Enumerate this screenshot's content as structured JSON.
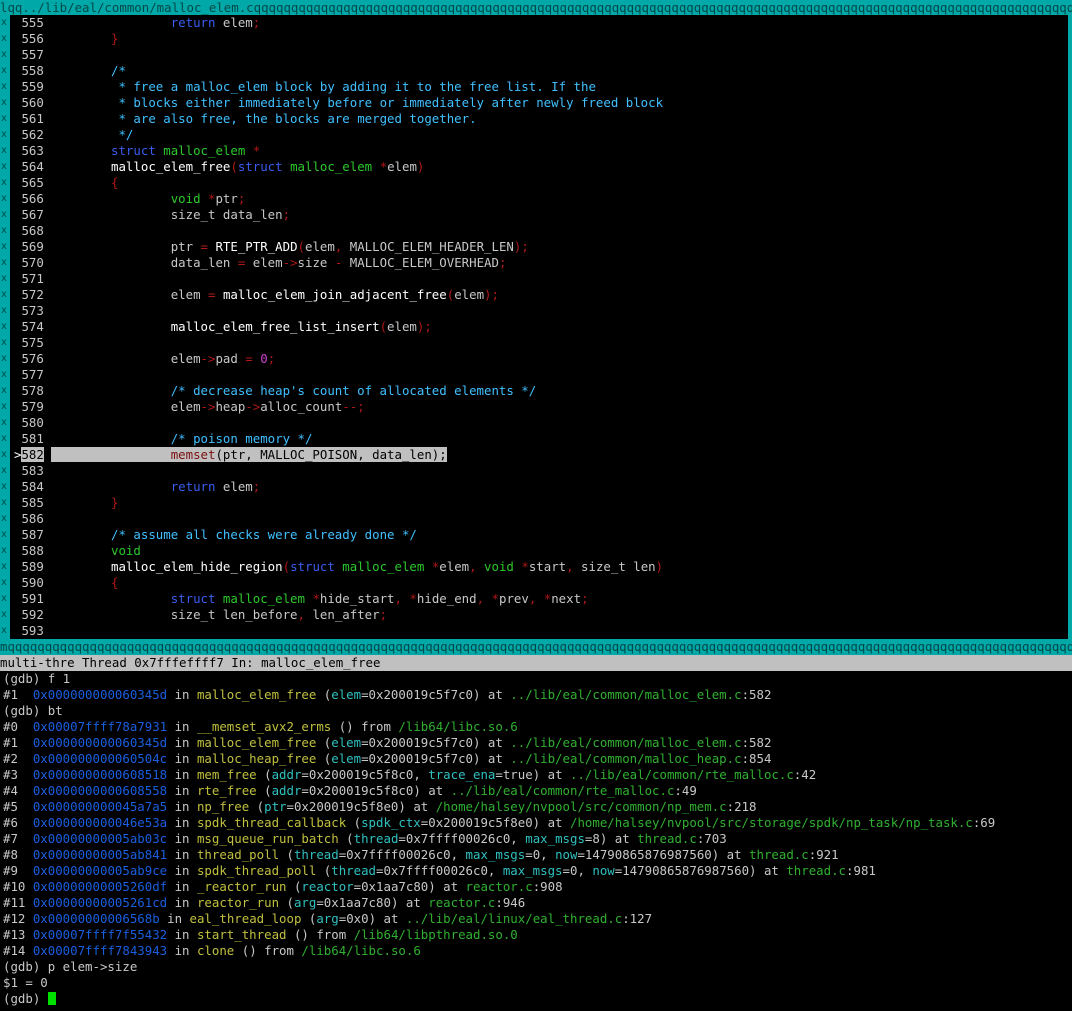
{
  "title_bar": "lqq../lib/eal/common/malloc_elem.cqqqqqqqqqqqqqqqqqqqqqqqqqqqqqqqqqqqqqqqqqqqqqqqqqqqqqqqqqqqqqqqqqqqqqqqqqqqqqqqqqqqqqqqqqqqqqqqqqqqqqqqqqqqqqqqqqqqqqqqqqqqqqqqqqqqqqqqqqqqqqqqqqqqqqqqqqqqqqqqqqqqqqqqqqqqqqqqqqqqqqqqqqqqqqqqqqqqqqqqqqqqq",
  "border_char": "x",
  "bottom_border": "mqqqqqqqqqqqqqqqqqqqqqqqqqqqqqqqqqqqqqqqqqqqqqqqqqqqqqqqqqqqqqqqqqqqqqqqqqqqqqqqqqqqqqqqqqqqqqqqqqqqqqqqqqqqqqqqqqqqqqqqqqqqqqqqqqqqqqqqqqqqqqqqqqqqqqqqqqqqqqqqqqqqqqqqqqqqqqqqqqqqqqqqqqqqqqqqqqqqqqqqqqqqqqqqqqqqqqqqqqqqqqqqqqqqqqqqqqqqqqqqqqqqq",
  "status_bar": "multi-thre Thread 0x7fffeffff7 In: malloc_elem_free",
  "current_line": 582,
  "source_lines": [
    {
      "n": 555,
      "t": [
        [
          "                ",
          ""
        ],
        [
          "return",
          "kw"
        ],
        [
          " elem",
          "id"
        ],
        [
          ";",
          "pun"
        ]
      ]
    },
    {
      "n": 556,
      "t": [
        [
          "        ",
          ""
        ],
        [
          "}",
          "pun"
        ]
      ]
    },
    {
      "n": 557,
      "t": []
    },
    {
      "n": 558,
      "t": [
        [
          "        ",
          ""
        ],
        [
          "/*",
          "cm"
        ]
      ]
    },
    {
      "n": 559,
      "t": [
        [
          "        ",
          ""
        ],
        [
          " * free a malloc_elem block by adding it to the free list. If the",
          "cm"
        ]
      ]
    },
    {
      "n": 560,
      "t": [
        [
          "        ",
          ""
        ],
        [
          " * blocks either immediately before or immediately after newly freed block",
          "cm"
        ]
      ]
    },
    {
      "n": 561,
      "t": [
        [
          "        ",
          ""
        ],
        [
          " * are also free, the blocks are merged together.",
          "cm"
        ]
      ]
    },
    {
      "n": 562,
      "t": [
        [
          "        ",
          ""
        ],
        [
          " */",
          "cm"
        ]
      ]
    },
    {
      "n": 563,
      "t": [
        [
          "        ",
          ""
        ],
        [
          "struct",
          "kw"
        ],
        [
          " ",
          ""
        ],
        [
          "malloc_elem",
          "ty"
        ],
        [
          " *",
          "pun"
        ]
      ]
    },
    {
      "n": 564,
      "t": [
        [
          "        ",
          ""
        ],
        [
          "malloc_elem_free",
          "fnc"
        ],
        [
          "(",
          "pun"
        ],
        [
          "struct",
          "kw"
        ],
        [
          " ",
          ""
        ],
        [
          "malloc_elem",
          "ty"
        ],
        [
          " *",
          "pun"
        ],
        [
          "elem",
          "id"
        ],
        [
          ")",
          "pun"
        ]
      ]
    },
    {
      "n": 565,
      "t": [
        [
          "        ",
          ""
        ],
        [
          "{",
          "pun"
        ]
      ]
    },
    {
      "n": 566,
      "t": [
        [
          "                ",
          ""
        ],
        [
          "void",
          "ty"
        ],
        [
          " *",
          "pun"
        ],
        [
          "ptr",
          "id"
        ],
        [
          ";",
          "pun"
        ]
      ]
    },
    {
      "n": 567,
      "t": [
        [
          "                ",
          ""
        ],
        [
          "size_t data_len",
          "id"
        ],
        [
          ";",
          "pun"
        ]
      ]
    },
    {
      "n": 568,
      "t": []
    },
    {
      "n": 569,
      "t": [
        [
          "                ",
          ""
        ],
        [
          "ptr ",
          "id"
        ],
        [
          "=",
          "pun"
        ],
        [
          " ",
          ""
        ],
        [
          "RTE_PTR_ADD",
          "fnc"
        ],
        [
          "(",
          "pun"
        ],
        [
          "elem",
          ""
        ],
        [
          ", ",
          "pun"
        ],
        [
          "MALLOC_ELEM_HEADER_LEN",
          "mac"
        ],
        [
          ");",
          "pun"
        ]
      ]
    },
    {
      "n": 570,
      "t": [
        [
          "                ",
          ""
        ],
        [
          "data_len ",
          "id"
        ],
        [
          "=",
          "pun"
        ],
        [
          " elem",
          "id"
        ],
        [
          "->",
          "pun"
        ],
        [
          "size ",
          "id"
        ],
        [
          "-",
          "pun"
        ],
        [
          " MALLOC_ELEM_OVERHEAD",
          "mac"
        ],
        [
          ";",
          "pun"
        ]
      ]
    },
    {
      "n": 571,
      "t": []
    },
    {
      "n": 572,
      "t": [
        [
          "                ",
          ""
        ],
        [
          "elem ",
          "id"
        ],
        [
          "=",
          "pun"
        ],
        [
          " ",
          ""
        ],
        [
          "malloc_elem_join_adjacent_free",
          "fnc"
        ],
        [
          "(",
          "pun"
        ],
        [
          "elem",
          "id"
        ],
        [
          ");",
          "pun"
        ]
      ]
    },
    {
      "n": 573,
      "t": []
    },
    {
      "n": 574,
      "t": [
        [
          "                ",
          ""
        ],
        [
          "malloc_elem_free_list_insert",
          "fnc"
        ],
        [
          "(",
          "pun"
        ],
        [
          "elem",
          "id"
        ],
        [
          ");",
          "pun"
        ]
      ]
    },
    {
      "n": 575,
      "t": []
    },
    {
      "n": 576,
      "t": [
        [
          "                ",
          ""
        ],
        [
          "elem",
          "id"
        ],
        [
          "->",
          "pun"
        ],
        [
          "pad ",
          "id"
        ],
        [
          "=",
          "pun"
        ],
        [
          " ",
          ""
        ],
        [
          "0",
          "num"
        ],
        [
          ";",
          "pun"
        ]
      ]
    },
    {
      "n": 577,
      "t": []
    },
    {
      "n": 578,
      "t": [
        [
          "                ",
          ""
        ],
        [
          "/* decrease heap's count of allocated elements */",
          "cm"
        ]
      ]
    },
    {
      "n": 579,
      "t": [
        [
          "                ",
          ""
        ],
        [
          "elem",
          "id"
        ],
        [
          "->",
          "pun"
        ],
        [
          "heap",
          "id"
        ],
        [
          "->",
          "pun"
        ],
        [
          "alloc_count",
          "id"
        ],
        [
          "--;",
          "pun"
        ]
      ]
    },
    {
      "n": 580,
      "t": []
    },
    {
      "n": 581,
      "t": [
        [
          "                ",
          ""
        ],
        [
          "/* poison memory */",
          "cm"
        ]
      ]
    },
    {
      "n": 582,
      "t": [
        [
          "                ",
          ""
        ],
        [
          "memset",
          "fnc"
        ],
        [
          "(ptr, MALLOC_POISON, data_len);",
          ""
        ]
      ]
    },
    {
      "n": 583,
      "t": []
    },
    {
      "n": 584,
      "t": [
        [
          "                ",
          ""
        ],
        [
          "return",
          "kw"
        ],
        [
          " elem",
          "id"
        ],
        [
          ";",
          "pun"
        ]
      ]
    },
    {
      "n": 585,
      "t": [
        [
          "        ",
          ""
        ],
        [
          "}",
          "pun"
        ]
      ]
    },
    {
      "n": 586,
      "t": []
    },
    {
      "n": 587,
      "t": [
        [
          "        ",
          ""
        ],
        [
          "/* assume all checks were already done */",
          "cm"
        ]
      ]
    },
    {
      "n": 588,
      "t": [
        [
          "        ",
          ""
        ],
        [
          "void",
          "ty"
        ]
      ]
    },
    {
      "n": 589,
      "t": [
        [
          "        ",
          ""
        ],
        [
          "malloc_elem_hide_region",
          "fnc"
        ],
        [
          "(",
          "pun"
        ],
        [
          "struct",
          "kw"
        ],
        [
          " ",
          ""
        ],
        [
          "malloc_elem",
          "ty"
        ],
        [
          " *",
          "pun"
        ],
        [
          "elem",
          "id"
        ],
        [
          ", ",
          "pun"
        ],
        [
          "void",
          "ty"
        ],
        [
          " *",
          "pun"
        ],
        [
          "start",
          "id"
        ],
        [
          ", ",
          "pun"
        ],
        [
          "size_t len",
          "id"
        ],
        [
          ")",
          "pun"
        ]
      ]
    },
    {
      "n": 590,
      "t": [
        [
          "        ",
          ""
        ],
        [
          "{",
          "pun"
        ]
      ]
    },
    {
      "n": 591,
      "t": [
        [
          "                ",
          ""
        ],
        [
          "struct",
          "kw"
        ],
        [
          " ",
          ""
        ],
        [
          "malloc_elem",
          "ty"
        ],
        [
          " *",
          "pun"
        ],
        [
          "hide_start",
          "id"
        ],
        [
          ", *",
          "pun"
        ],
        [
          "hide_end",
          "id"
        ],
        [
          ", *",
          "pun"
        ],
        [
          "prev",
          "id"
        ],
        [
          ", *",
          "pun"
        ],
        [
          "next",
          "id"
        ],
        [
          ";",
          "pun"
        ]
      ]
    },
    {
      "n": 592,
      "t": [
        [
          "                ",
          ""
        ],
        [
          "size_t len_before",
          "id"
        ],
        [
          ", ",
          "pun"
        ],
        [
          "len_after",
          "id"
        ],
        [
          ";",
          "pun"
        ]
      ]
    },
    {
      "n": 593,
      "t": []
    }
  ],
  "console_lines": [
    [
      [
        "(gdb) f 1",
        "c-prompt"
      ]
    ],
    [
      [
        "#1  ",
        "c-frame"
      ],
      [
        "0x000000000060345d",
        "c-addr"
      ],
      [
        " in ",
        "c-txt"
      ],
      [
        "malloc_elem_free",
        "c-fn"
      ],
      [
        " (",
        "c-txt"
      ],
      [
        "elem",
        "c-arg"
      ],
      [
        "=0x200019c5f7c0) at ",
        "c-txt"
      ],
      [
        "../lib/eal/common/malloc_elem.c",
        "c-file"
      ],
      [
        ":582",
        "c-txt"
      ]
    ],
    [
      [
        "(gdb) bt",
        "c-prompt"
      ]
    ],
    [
      [
        "#0  ",
        "c-frame"
      ],
      [
        "0x00007ffff78a7931",
        "c-addr"
      ],
      [
        " in ",
        "c-txt"
      ],
      [
        "__memset_avx2_erms",
        "c-fn"
      ],
      [
        " () from ",
        "c-txt"
      ],
      [
        "/lib64/libc.so.6",
        "c-file"
      ]
    ],
    [
      [
        "#1  ",
        "c-frame"
      ],
      [
        "0x000000000060345d",
        "c-addr"
      ],
      [
        " in ",
        "c-txt"
      ],
      [
        "malloc_elem_free",
        "c-fn"
      ],
      [
        " (",
        "c-txt"
      ],
      [
        "elem",
        "c-arg"
      ],
      [
        "=0x200019c5f7c0) at ",
        "c-txt"
      ],
      [
        "../lib/eal/common/malloc_elem.c",
        "c-file"
      ],
      [
        ":582",
        "c-txt"
      ]
    ],
    [
      [
        "#2  ",
        "c-frame"
      ],
      [
        "0x000000000060504c",
        "c-addr"
      ],
      [
        " in ",
        "c-txt"
      ],
      [
        "malloc_heap_free",
        "c-fn"
      ],
      [
        " (",
        "c-txt"
      ],
      [
        "elem",
        "c-arg"
      ],
      [
        "=0x200019c5f7c0) at ",
        "c-txt"
      ],
      [
        "../lib/eal/common/malloc_heap.c",
        "c-file"
      ],
      [
        ":854",
        "c-txt"
      ]
    ],
    [
      [
        "#3  ",
        "c-frame"
      ],
      [
        "0x0000000000608518",
        "c-addr"
      ],
      [
        " in ",
        "c-txt"
      ],
      [
        "mem_free",
        "c-fn"
      ],
      [
        " (",
        "c-txt"
      ],
      [
        "addr",
        "c-arg"
      ],
      [
        "=0x200019c5f8c0, ",
        "c-txt"
      ],
      [
        "trace_ena",
        "c-arg"
      ],
      [
        "=true) at ",
        "c-txt"
      ],
      [
        "../lib/eal/common/rte_malloc.c",
        "c-file"
      ],
      [
        ":42",
        "c-txt"
      ]
    ],
    [
      [
        "#4  ",
        "c-frame"
      ],
      [
        "0x0000000000608558",
        "c-addr"
      ],
      [
        " in ",
        "c-txt"
      ],
      [
        "rte_free",
        "c-fn"
      ],
      [
        " (",
        "c-txt"
      ],
      [
        "addr",
        "c-arg"
      ],
      [
        "=0x200019c5f8c0) at ",
        "c-txt"
      ],
      [
        "../lib/eal/common/rte_malloc.c",
        "c-file"
      ],
      [
        ":49",
        "c-txt"
      ]
    ],
    [
      [
        "#5  ",
        "c-frame"
      ],
      [
        "0x000000000045a7a5",
        "c-addr"
      ],
      [
        " in ",
        "c-txt"
      ],
      [
        "np_free",
        "c-fn"
      ],
      [
        " (",
        "c-txt"
      ],
      [
        "ptr",
        "c-arg"
      ],
      [
        "=0x200019c5f8e0) at ",
        "c-txt"
      ],
      [
        "/home/halsey/nvpool/src/common/np_mem.c",
        "c-file"
      ],
      [
        ":218",
        "c-txt"
      ]
    ],
    [
      [
        "#6  ",
        "c-frame"
      ],
      [
        "0x000000000046e53a",
        "c-addr"
      ],
      [
        " in ",
        "c-txt"
      ],
      [
        "spdk_thread_callback",
        "c-fn"
      ],
      [
        " (",
        "c-txt"
      ],
      [
        "spdk_ctx",
        "c-arg"
      ],
      [
        "=0x200019c5f8e0) at ",
        "c-txt"
      ],
      [
        "/home/halsey/nvpool/src/storage/spdk/np_task/np_task.c",
        "c-file"
      ],
      [
        ":69",
        "c-txt"
      ]
    ],
    [
      [
        "#7  ",
        "c-frame"
      ],
      [
        "0x00000000005ab03c",
        "c-addr"
      ],
      [
        " in ",
        "c-txt"
      ],
      [
        "msg_queue_run_batch",
        "c-fn"
      ],
      [
        " (",
        "c-txt"
      ],
      [
        "thread",
        "c-arg"
      ],
      [
        "=0x7ffff00026c0, ",
        "c-txt"
      ],
      [
        "max_msgs",
        "c-arg"
      ],
      [
        "=8) at ",
        "c-txt"
      ],
      [
        "thread.c",
        "c-file"
      ],
      [
        ":703",
        "c-txt"
      ]
    ],
    [
      [
        "#8  ",
        "c-frame"
      ],
      [
        "0x00000000005ab841",
        "c-addr"
      ],
      [
        " in ",
        "c-txt"
      ],
      [
        "thread_poll",
        "c-fn"
      ],
      [
        " (",
        "c-txt"
      ],
      [
        "thread",
        "c-arg"
      ],
      [
        "=0x7ffff00026c0, ",
        "c-txt"
      ],
      [
        "max_msgs",
        "c-arg"
      ],
      [
        "=0, ",
        "c-txt"
      ],
      [
        "now",
        "c-arg"
      ],
      [
        "=14790865876987560) at ",
        "c-txt"
      ],
      [
        "thread.c",
        "c-file"
      ],
      [
        ":921",
        "c-txt"
      ]
    ],
    [
      [
        "#9  ",
        "c-frame"
      ],
      [
        "0x00000000005ab9ce",
        "c-addr"
      ],
      [
        " in ",
        "c-txt"
      ],
      [
        "spdk_thread_poll",
        "c-fn"
      ],
      [
        " (",
        "c-txt"
      ],
      [
        "thread",
        "c-arg"
      ],
      [
        "=0x7ffff00026c0, ",
        "c-txt"
      ],
      [
        "max_msgs",
        "c-arg"
      ],
      [
        "=0, ",
        "c-txt"
      ],
      [
        "now",
        "c-arg"
      ],
      [
        "=14790865876987560) at ",
        "c-txt"
      ],
      [
        "thread.c",
        "c-file"
      ],
      [
        ":981",
        "c-txt"
      ]
    ],
    [
      [
        "#10 ",
        "c-frame"
      ],
      [
        "0x00000000005260df",
        "c-addr"
      ],
      [
        " in ",
        "c-txt"
      ],
      [
        "_reactor_run",
        "c-fn"
      ],
      [
        " (",
        "c-txt"
      ],
      [
        "reactor",
        "c-arg"
      ],
      [
        "=0x1aa7c80) at ",
        "c-txt"
      ],
      [
        "reactor.c",
        "c-file"
      ],
      [
        ":908",
        "c-txt"
      ]
    ],
    [
      [
        "#11 ",
        "c-frame"
      ],
      [
        "0x00000000005261cd",
        "c-addr"
      ],
      [
        " in ",
        "c-txt"
      ],
      [
        "reactor_run",
        "c-fn"
      ],
      [
        " (",
        "c-txt"
      ],
      [
        "arg",
        "c-arg"
      ],
      [
        "=0x1aa7c80) at ",
        "c-txt"
      ],
      [
        "reactor.c",
        "c-file"
      ],
      [
        ":946",
        "c-txt"
      ]
    ],
    [
      [
        "#12 ",
        "c-frame"
      ],
      [
        "0x00000000006568b",
        "c-addr"
      ],
      [
        " in ",
        "c-txt"
      ],
      [
        "eal_thread_loop",
        "c-fn"
      ],
      [
        " (",
        "c-txt"
      ],
      [
        "arg",
        "c-arg"
      ],
      [
        "=0x0) at ",
        "c-txt"
      ],
      [
        "../lib/eal/linux/eal_thread.c",
        "c-file"
      ],
      [
        ":127",
        "c-txt"
      ]
    ],
    [
      [
        "#13 ",
        "c-frame"
      ],
      [
        "0x00007ffff7f55432",
        "c-addr"
      ],
      [
        " in ",
        "c-txt"
      ],
      [
        "start_thread",
        "c-fn"
      ],
      [
        " () from ",
        "c-txt"
      ],
      [
        "/lib64/libpthread.so.0",
        "c-file"
      ]
    ],
    [
      [
        "#14 ",
        "c-frame"
      ],
      [
        "0x00007ffff7843943",
        "c-addr"
      ],
      [
        " in ",
        "c-txt"
      ],
      [
        "clone",
        "c-fn"
      ],
      [
        " () from ",
        "c-txt"
      ],
      [
        "/lib64/libc.so.6",
        "c-file"
      ]
    ],
    [
      [
        "(gdb) p elem->size",
        "c-prompt"
      ]
    ],
    [
      [
        "$1 = 0",
        "c-prompt"
      ]
    ],
    [
      [
        "(gdb) ",
        "c-prompt"
      ]
    ]
  ],
  "colors": {
    "border": "#00a8a8",
    "status_bg": "#c0c0c0",
    "cursor": "#00e000"
  }
}
